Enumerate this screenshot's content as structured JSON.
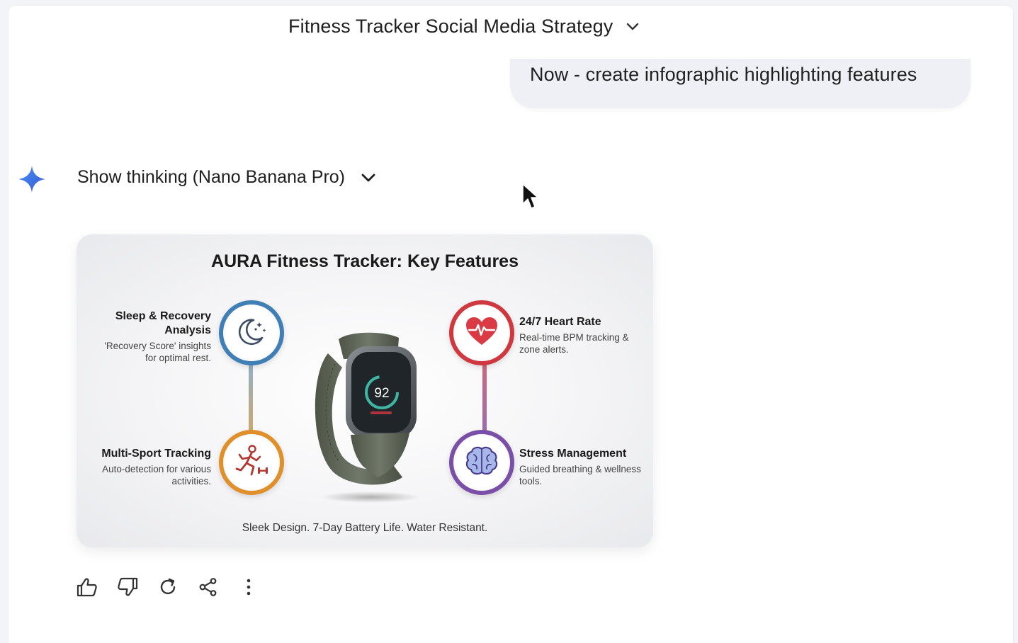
{
  "header": {
    "chat_title": "Fitness Tracker Social Media Strategy",
    "title_dropdown_icon": "chevron-down-icon"
  },
  "user_message": {
    "text": "Now - create infographic highlighting features"
  },
  "response": {
    "assistant_icon": "gemini-spark-icon",
    "thinking_label": "Show thinking (Nano Banana Pro)",
    "thinking_toggle_icon": "chevron-down-icon"
  },
  "infographic": {
    "title": "AURA Fitness Tracker: Key Features",
    "features": [
      {
        "id": "sleep",
        "title": "Sleep & Recovery Analysis",
        "desc": "'Recovery Score' insights for optimal rest.",
        "icon": "moon-stars-icon",
        "color": "#3f7fb5"
      },
      {
        "id": "heart",
        "title": "24/7 Heart Rate",
        "desc": "Real-time BPM tracking & zone alerts.",
        "icon": "heart-pulse-icon",
        "color": "#d0383f"
      },
      {
        "id": "sport",
        "title": "Multi-Sport Tracking",
        "desc": "Auto-detection for various activities.",
        "icon": "runner-icon",
        "color": "#e0902a"
      },
      {
        "id": "stress",
        "title": "Stress Management",
        "desc": "Guided breathing & wellness tools.",
        "icon": "brain-icon",
        "color": "#7a4fa8"
      }
    ],
    "watch_reading": "92",
    "footer": "Sleek Design. 7-Day Battery Life. Water Resistant."
  },
  "actions": [
    {
      "name": "thumbs-up-button",
      "icon": "thumbs-up-icon"
    },
    {
      "name": "thumbs-down-button",
      "icon": "thumbs-down-icon"
    },
    {
      "name": "regenerate-button",
      "icon": "refresh-icon"
    },
    {
      "name": "share-button",
      "icon": "share-icon"
    },
    {
      "name": "more-options-button",
      "icon": "more-vertical-icon"
    }
  ]
}
